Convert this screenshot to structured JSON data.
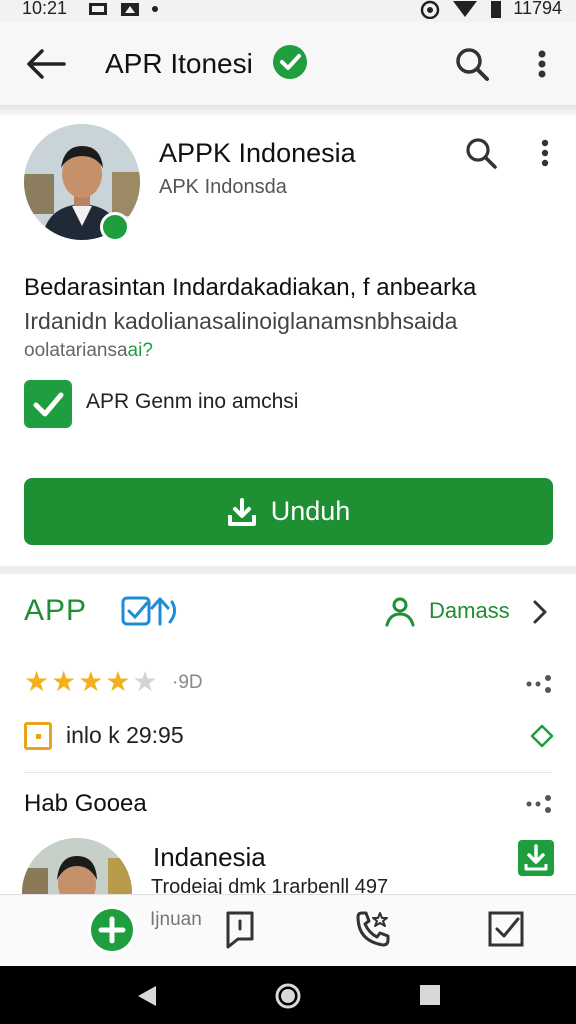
{
  "status_bar": {
    "time": "10:21",
    "right_text": "11794"
  },
  "app_bar": {
    "title": "APR Itonesi"
  },
  "profile": {
    "name": "APPK Indonesia",
    "subtitle": "APK Indonsda"
  },
  "description": {
    "title": "Bedarasintan Indardakadiakan, f anbearka",
    "line2": "Irdanidn kadolianasalinoiglanamsnbhsaida",
    "line3": "oolatariansa",
    "line3_tag": "ai?"
  },
  "checkbox": {
    "label": "APR Genm ino amchsi",
    "checked": true
  },
  "download_button": {
    "label": "Unduh"
  },
  "app_row": {
    "label": "APP",
    "people_label": "Damass"
  },
  "rating": {
    "stars_filled": 4,
    "stars_total": 5,
    "count_text": "·9D"
  },
  "info": {
    "text": "inlo k 29:95"
  },
  "section": {
    "title": "Hab Gooea"
  },
  "list_item": {
    "title": "Indanesia",
    "subtitle": "Trodeiaj dmk 1rarbenll 497"
  },
  "bottom_nav": {
    "label": "Ijnuan"
  },
  "colors": {
    "accent": "#1e8f33",
    "star": "#f2b01e",
    "info": "#e8a51a"
  },
  "icons": [
    "back-arrow-icon",
    "verified-icon",
    "search-icon",
    "more-vert-icon",
    "download-icon",
    "people-icon",
    "chevron-right-icon",
    "star-icon",
    "diamond-icon",
    "plus-icon",
    "chat-icon",
    "phone-star-icon",
    "checkbox-icon"
  ]
}
